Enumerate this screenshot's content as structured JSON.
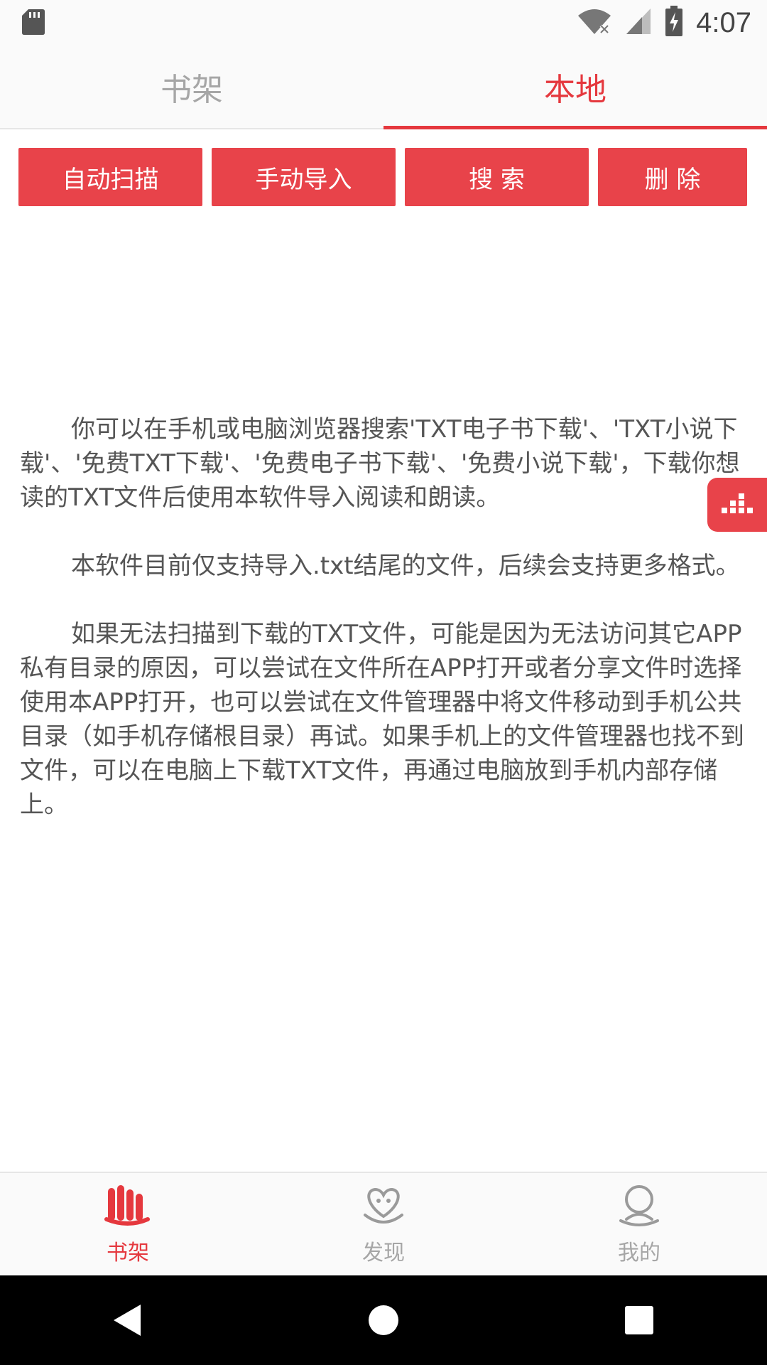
{
  "status_bar": {
    "time": "4:07",
    "icons": [
      "sd-card-icon",
      "wifi-icon",
      "signal-icon",
      "battery-charging-icon"
    ]
  },
  "top_tabs": [
    {
      "label": "书架",
      "active": false
    },
    {
      "label": "本地",
      "active": true
    }
  ],
  "actions": {
    "auto_scan": "自动扫描",
    "manual_import": "手动导入",
    "search": "搜 索",
    "delete": "删 除"
  },
  "content": {
    "paragraphs": [
      "你可以在手机或电脑浏览器搜索'TXT电子书下载'、'TXT小说下载'、'免费TXT下载'、'免费电子书下载'、'免费小说下载'，下载你想读的TXT文件后使用本软件导入阅读和朗读。",
      "本软件目前仅支持导入.txt结尾的文件，后续会支持更多格式。",
      "如果无法扫描到下载的TXT文件，可能是因为无法访问其它APP私有目录的原因，可以尝试在文件所在APP打开或者分享文件时选择使用本APP打开，也可以尝试在文件管理器中将文件移动到手机公共目录（如手机存储根目录）再试。如果手机上的文件管理器也找不到文件，可以在电脑上下载TXT文件，再通过电脑放到手机内部存储上。"
    ]
  },
  "bottom_nav": [
    {
      "label": "书架",
      "icon": "bookshelf-icon",
      "active": true
    },
    {
      "label": "发现",
      "icon": "discover-icon",
      "active": false
    },
    {
      "label": "我的",
      "icon": "profile-icon",
      "active": false
    }
  ],
  "colors": {
    "accent": "#e5383e",
    "button": "#e8434a",
    "inactive": "#a6a6a6"
  }
}
